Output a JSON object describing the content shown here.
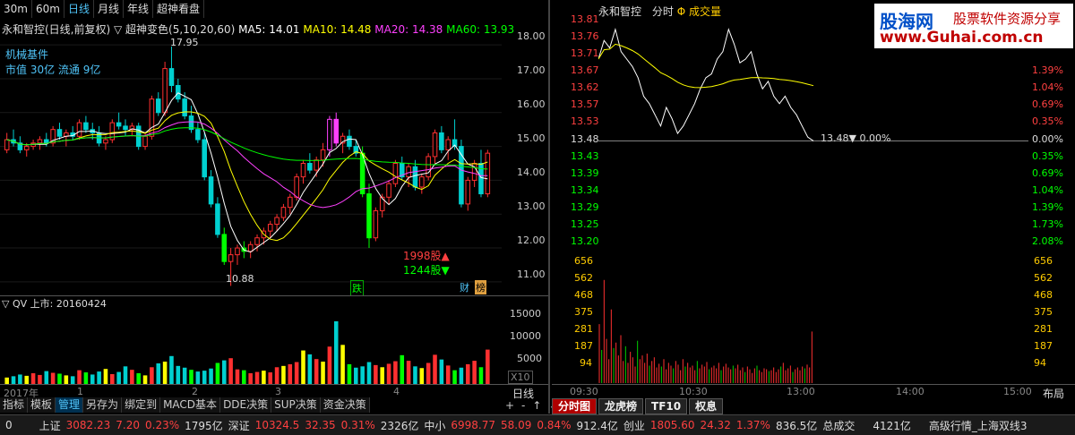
{
  "top_tabs": [
    "30m",
    "60m",
    "日线",
    "月线",
    "年线",
    "超神看盘"
  ],
  "active_tab": 2,
  "stock_title": "永和智控(日线,前复权)",
  "indicator_name": "▽ 超神变色(5,10,20,60)",
  "ma": [
    {
      "label": "MA5: 14.01",
      "color": "#ffffff"
    },
    {
      "label": "MA10: 14.48",
      "color": "#ffff00"
    },
    {
      "label": "MA20: 14.38",
      "color": "#ff00ff"
    },
    {
      "label": "MA60: 13.93",
      "color": "#00ff00"
    }
  ],
  "info_lines": [
    "机械基件",
    "市值 30亿  流通 9亿"
  ],
  "high_label": "17.95",
  "low_label": "10.88",
  "up_count": "1998股▲",
  "down_count": "1244股▼",
  "tags": {
    "die": "跌",
    "cai": "财",
    "bang": "榜"
  },
  "left_y_axis": [
    "18.00",
    "17.00",
    "16.00",
    "15.00",
    "14.00",
    "13.00",
    "12.00",
    "11.00"
  ],
  "vol_title": "▽ QV 上市: 20160424",
  "vol_y_axis": [
    "15000",
    "10000",
    "5000"
  ],
  "vol_unit": "X10",
  "x_labels": [
    "2017年",
    "1",
    "2",
    "3",
    "4"
  ],
  "period": "日线",
  "bottom_tabs": [
    "指标",
    "模板",
    "管理",
    "另存为",
    "绑定到",
    "MACD基本",
    "DDE决策",
    "SUP决策",
    "资金决策"
  ],
  "bottom_active": 2,
  "right_title": "永和智控",
  "right_mode": "分时",
  "right_vol": "Φ 成交量",
  "right_price_axis": [
    "13.81",
    "13.76",
    "13.71",
    "13.67",
    "13.62",
    "13.57",
    "13.53",
    "13.48",
    "13.43",
    "13.39",
    "13.34",
    "13.29",
    "13.25",
    "13.20"
  ],
  "right_pct_axis": [
    "",
    "",
    "1.39%",
    "1.04%",
    "0.69%",
    "0.35%",
    "0.00%",
    "0.35%",
    "0.69%",
    "1.04%",
    "1.39%",
    "1.73%",
    "2.08%"
  ],
  "last_price_label": "13.48▼  0.00%",
  "right_vol_axis": [
    "656",
    "562",
    "468",
    "375",
    "281",
    "187",
    "94"
  ],
  "right_time_axis": [
    "09:30",
    "10:30",
    "13:00",
    "14:00",
    "15:00"
  ],
  "layout_label": "布局",
  "right_tabs": [
    "分时图",
    "龙虎榜",
    "TF10",
    "权息"
  ],
  "status": {
    "idx0": "0",
    "sh_name": "上证",
    "sh_val": "3082.23",
    "sh_chg": "7.20",
    "sh_pct": "0.23%",
    "sh_amt": "1795亿",
    "sz_name": "深证",
    "sz_val": "10324.5",
    "sz_chg": "32.35",
    "sz_pct": "0.31%",
    "sz_amt": "2326亿",
    "zx_name": "中小",
    "zx_val": "6998.77",
    "zx_chg": "58.09",
    "zx_pct": "0.84%",
    "zx_amt": "912.4亿",
    "cy_name": "创业",
    "cy_val": "1805.60",
    "cy_chg": "24.32",
    "cy_pct": "1.37%",
    "cy_amt": "836.5亿",
    "total_label": "总成交",
    "total_val": "4121亿",
    "market_label": "高级行情_上海双线3"
  },
  "watermark": {
    "line1": "股海网",
    "line2": "www.Guhai.com.cn",
    "side1": "股票软件资源分享"
  },
  "chart_data": [
    {
      "type": "candlestick",
      "title": "永和智控(日线,前复权)",
      "ylim": [
        10.6,
        18.4
      ],
      "candles": [
        [
          14.9,
          15.4,
          14.8,
          15.2
        ],
        [
          15.2,
          15.5,
          15.0,
          15.1
        ],
        [
          15.1,
          15.3,
          14.8,
          14.9
        ],
        [
          14.9,
          15.1,
          14.7,
          15.0
        ],
        [
          15.0,
          15.2,
          14.9,
          15.1
        ],
        [
          15.1,
          15.3,
          14.9,
          15.2
        ],
        [
          15.2,
          15.4,
          15.0,
          15.1
        ],
        [
          15.1,
          15.6,
          15.0,
          15.5
        ],
        [
          15.5,
          15.7,
          15.2,
          15.3
        ],
        [
          15.3,
          15.5,
          15.0,
          15.4
        ],
        [
          15.4,
          15.6,
          15.2,
          15.3
        ],
        [
          15.3,
          15.8,
          15.2,
          15.7
        ],
        [
          15.7,
          15.9,
          15.4,
          15.5
        ],
        [
          15.5,
          15.7,
          15.2,
          15.4
        ],
        [
          15.4,
          15.6,
          15.0,
          15.1
        ],
        [
          15.1,
          15.3,
          14.9,
          15.2
        ],
        [
          15.2,
          15.8,
          15.1,
          15.7
        ],
        [
          15.7,
          16.0,
          15.5,
          15.6
        ],
        [
          15.6,
          15.8,
          15.3,
          15.5
        ],
        [
          15.5,
          15.7,
          15.3,
          15.6
        ],
        [
          15.6,
          15.7,
          14.9,
          15.0
        ],
        [
          15.0,
          15.4,
          14.9,
          15.3
        ],
        [
          15.3,
          16.5,
          15.2,
          16.4
        ],
        [
          16.4,
          16.6,
          15.9,
          16.0
        ],
        [
          16.0,
          17.5,
          15.9,
          17.3
        ],
        [
          17.3,
          17.95,
          16.6,
          16.8
        ],
        [
          16.8,
          17.0,
          16.3,
          16.4
        ],
        [
          16.4,
          16.6,
          15.8,
          15.9
        ],
        [
          15.9,
          16.2,
          15.4,
          15.5
        ],
        [
          15.5,
          15.7,
          15.1,
          15.2
        ],
        [
          15.2,
          15.4,
          14.0,
          14.1
        ],
        [
          14.1,
          14.3,
          13.2,
          13.3
        ],
        [
          13.3,
          13.5,
          12.3,
          12.4
        ],
        [
          12.4,
          12.6,
          11.5,
          11.6
        ],
        [
          11.6,
          12.0,
          10.88,
          11.8
        ],
        [
          11.8,
          12.1,
          11.5,
          12.0
        ],
        [
          12.0,
          12.2,
          11.7,
          11.9
        ],
        [
          11.9,
          12.2,
          11.7,
          12.1
        ],
        [
          12.1,
          12.4,
          11.9,
          12.3
        ],
        [
          12.3,
          12.6,
          12.1,
          12.5
        ],
        [
          12.5,
          12.8,
          12.3,
          12.7
        ],
        [
          12.7,
          13.0,
          12.5,
          12.9
        ],
        [
          12.9,
          13.3,
          12.8,
          13.2
        ],
        [
          13.2,
          13.6,
          13.0,
          13.5
        ],
        [
          13.5,
          14.2,
          13.4,
          14.1
        ],
        [
          14.1,
          14.6,
          13.9,
          14.5
        ],
        [
          14.5,
          14.8,
          14.2,
          14.3
        ],
        [
          14.3,
          14.7,
          14.1,
          14.6
        ],
        [
          14.6,
          15.1,
          14.4,
          14.9
        ],
        [
          14.9,
          15.9,
          14.7,
          15.8
        ],
        [
          15.8,
          16.0,
          15.0,
          15.1
        ],
        [
          15.1,
          15.4,
          14.8,
          15.3
        ],
        [
          15.3,
          15.5,
          14.9,
          15.0
        ],
        [
          15.0,
          15.2,
          14.7,
          14.8
        ],
        [
          14.8,
          15.0,
          13.5,
          13.6
        ],
        [
          13.6,
          13.9,
          12.0,
          12.3
        ],
        [
          12.3,
          13.2,
          12.2,
          13.1
        ],
        [
          13.1,
          13.6,
          12.9,
          13.5
        ],
        [
          13.5,
          14.0,
          13.3,
          13.9
        ],
        [
          13.9,
          14.6,
          13.8,
          14.5
        ],
        [
          14.5,
          14.7,
          14.0,
          14.1
        ],
        [
          14.1,
          14.5,
          13.8,
          14.4
        ],
        [
          14.4,
          14.6,
          13.7,
          13.8
        ],
        [
          13.8,
          14.2,
          13.6,
          14.1
        ],
        [
          14.1,
          14.8,
          14.0,
          14.7
        ],
        [
          14.7,
          15.5,
          14.5,
          15.4
        ],
        [
          15.4,
          15.6,
          14.8,
          14.9
        ],
        [
          14.9,
          15.3,
          14.6,
          15.2
        ],
        [
          15.2,
          15.8,
          14.9,
          15.0
        ],
        [
          15.0,
          15.2,
          13.2,
          13.3
        ],
        [
          13.3,
          14.1,
          13.1,
          14.0
        ],
        [
          14.0,
          14.6,
          13.8,
          14.5
        ],
        [
          14.5,
          14.9,
          13.5,
          13.6
        ],
        [
          13.6,
          14.9,
          13.5,
          14.8
        ]
      ]
    },
    {
      "type": "bar",
      "title": "QV",
      "ylim": [
        0,
        17500
      ],
      "values": [
        1500,
        1800,
        2200,
        1900,
        2500,
        2100,
        3000,
        2600,
        2400,
        2000,
        1800,
        3200,
        2700,
        2200,
        2900,
        3500,
        2300,
        2800,
        4100,
        3300,
        2500,
        2000,
        3900,
        4800,
        5200,
        6500,
        4200,
        3800,
        3300,
        2900,
        3100,
        3600,
        4900,
        5500,
        6000,
        3400,
        3200,
        2500,
        2800,
        3100,
        2700,
        3900,
        4200,
        4600,
        5100,
        7800,
        6900,
        5800,
        5200,
        8700,
        14600,
        9100,
        4600,
        3800,
        4100,
        5100,
        4400,
        3900,
        4700,
        5300,
        6700,
        5400,
        4100,
        3700,
        4900,
        6800,
        5700,
        4300,
        3200,
        3800,
        4600,
        5400,
        3900,
        8000
      ]
    },
    {
      "type": "line",
      "title": "永和智控 分时",
      "ylim": [
        13.18,
        13.83
      ],
      "values": [
        13.7,
        13.75,
        13.73,
        13.78,
        13.72,
        13.7,
        13.68,
        13.65,
        13.6,
        13.58,
        13.55,
        13.52,
        13.57,
        13.54,
        13.5,
        13.52,
        13.55,
        13.58,
        13.62,
        13.65,
        13.66,
        13.7,
        13.72,
        13.78,
        13.74,
        13.69,
        13.7,
        13.72,
        13.66,
        13.62,
        13.64,
        13.6,
        13.58,
        13.6,
        13.57,
        13.55,
        13.52,
        13.49,
        13.48
      ]
    },
    {
      "type": "bar",
      "title": "成交量",
      "ylim": [
        0,
        700
      ],
      "values": [
        320,
        180,
        560,
        240,
        130,
        400,
        190,
        220,
        150,
        260,
        120,
        200,
        110,
        170,
        140,
        90,
        230,
        130,
        150,
        110,
        160,
        95,
        120,
        140,
        85,
        105,
        90,
        130,
        75,
        110,
        95,
        80,
        120,
        100,
        70,
        130,
        90,
        110,
        85,
        95,
        70,
        120,
        80,
        100,
        90,
        115,
        75,
        85,
        95,
        80,
        110,
        70,
        90,
        105,
        85,
        75,
        95,
        80,
        100,
        70,
        85,
        60,
        90,
        75,
        55,
        80,
        95,
        70,
        60,
        80,
        75,
        65,
        70,
        85,
        60,
        75,
        90,
        110,
        70,
        80,
        95,
        60,
        75,
        85,
        70,
        90,
        80,
        100,
        85,
        280
      ]
    }
  ]
}
